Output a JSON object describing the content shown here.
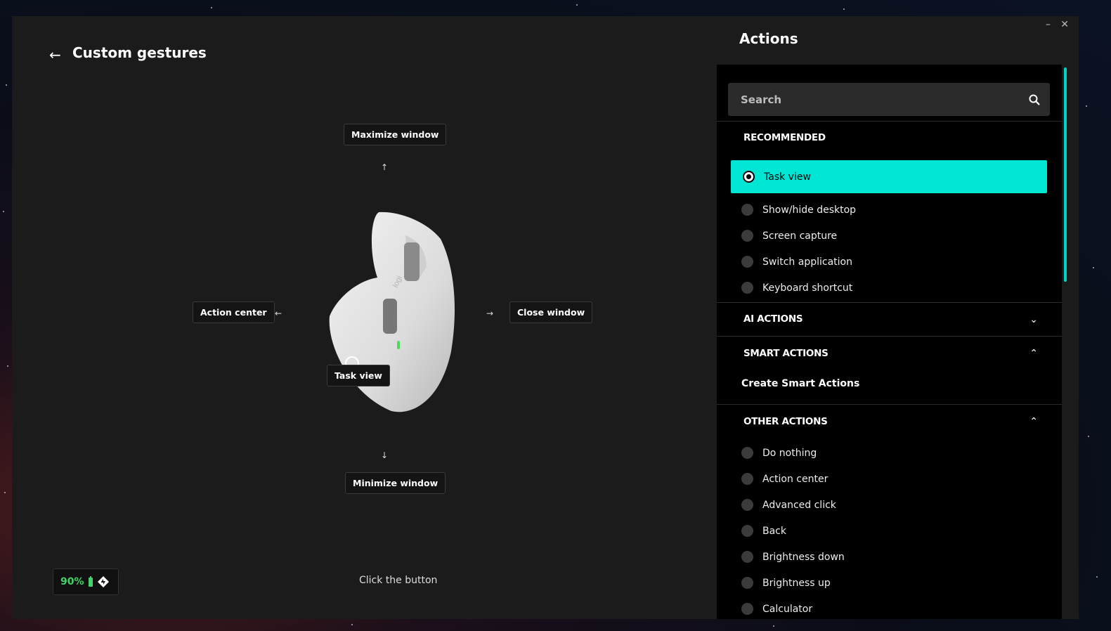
{
  "window": {
    "minimize_glyph": "–",
    "close_glyph": "✕"
  },
  "header": {
    "back_icon": "arrow-left-icon",
    "title": "Custom gestures"
  },
  "gestures": {
    "up": "Maximize window",
    "left": "Action center",
    "right": "Close window",
    "down": "Minimize window",
    "center": "Task view"
  },
  "device": {
    "battery_percent": "90%",
    "battery_icon": "battery-icon",
    "flow_icon": "logi-flow-icon"
  },
  "hint": "Click the button",
  "actions_panel": {
    "title": "Actions",
    "search_placeholder": "Search",
    "accent_color": "#00e5d4",
    "sections": {
      "recommended": {
        "title": "RECOMMENDED",
        "items": [
          "Task view",
          "Show/hide desktop",
          "Screen capture",
          "Switch application",
          "Keyboard shortcut"
        ],
        "selected": "Task view"
      },
      "ai_actions": {
        "title": "AI ACTIONS",
        "expanded": false
      },
      "smart_actions": {
        "title": "SMART ACTIONS",
        "expanded": true,
        "link": "Create Smart Actions"
      },
      "other_actions": {
        "title": "OTHER ACTIONS",
        "expanded": true,
        "items": [
          "Do nothing",
          "Action center",
          "Advanced click",
          "Back",
          "Brightness down",
          "Brightness up",
          "Calculator"
        ]
      }
    }
  }
}
